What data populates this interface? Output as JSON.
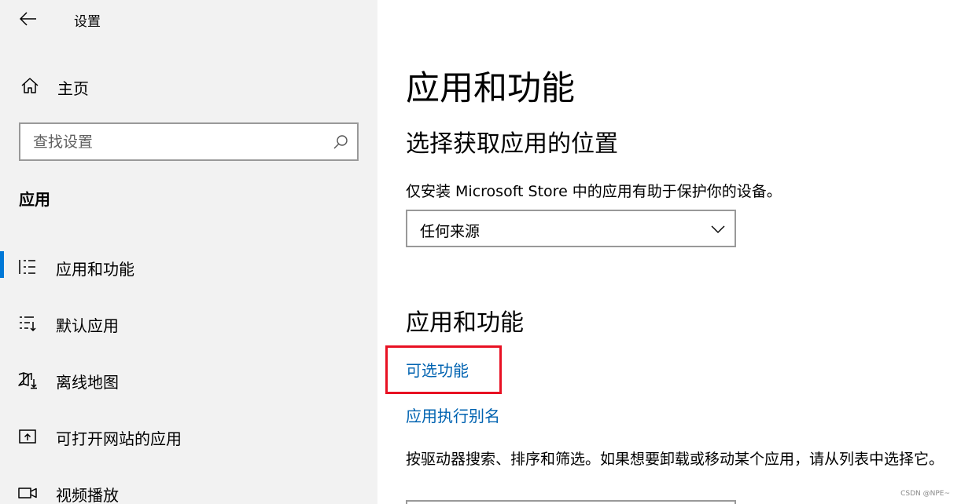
{
  "window": {
    "title": "设置"
  },
  "sidebar": {
    "home_label": "主页",
    "search_placeholder": "查找设置",
    "section_heading": "应用",
    "items": [
      {
        "label": "应用和功能",
        "icon": "list-icon",
        "active": true
      },
      {
        "label": "默认应用",
        "icon": "default-apps-icon",
        "active": false
      },
      {
        "label": "离线地图",
        "icon": "map-download-icon",
        "active": false
      },
      {
        "label": "可打开网站的应用",
        "icon": "open-web-icon",
        "active": false
      },
      {
        "label": "视频播放",
        "icon": "video-icon",
        "active": false
      }
    ]
  },
  "main": {
    "title": "应用和功能",
    "choose_source_heading": "选择获取应用的位置",
    "choose_source_desc": "仅安装 Microsoft Store 中的应用有助于保护你的设备。",
    "source_dropdown_value": "任何来源",
    "apps_heading": "应用和功能",
    "links": {
      "optional_features": "可选功能",
      "app_execution_aliases": "应用执行别名"
    },
    "search_desc": "按驱动器搜索、排序和筛选。如果想要卸载或移动某个应用，请从列表中选择它。"
  },
  "watermark": "CSDN @NPE~",
  "colors": {
    "accent": "#0078d7",
    "link": "#0063b1",
    "highlight": "#e81123",
    "sidebar_bg": "#f2f2f2"
  }
}
